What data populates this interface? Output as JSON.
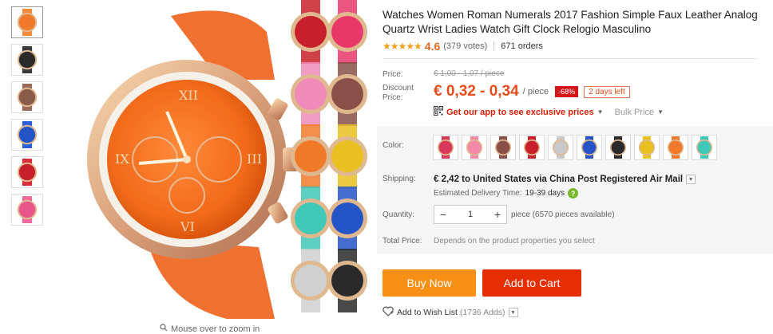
{
  "thumbnails": [
    {
      "face": "#f07a2a",
      "strap": "#f58c3a"
    },
    {
      "face": "#2a2a2a",
      "strap": "#3a3a3a"
    },
    {
      "face": "#8a5a4a",
      "strap": "#9a6a5a"
    },
    {
      "face": "#2554c7",
      "strap": "#2d5ed6"
    },
    {
      "face": "#c8202a",
      "strap": "#d8303a"
    },
    {
      "face": "#e8558a",
      "strap": "#f06a9a"
    }
  ],
  "zoom_hint": "Mouse over to zoom in",
  "product": {
    "title": "Watches Women Roman Numerals 2017 Fashion Simple Faux Leather Analog Quartz Wrist Ladies Watch Gift Clock Relogio Masculino",
    "stars": "★★★★★",
    "rating": "4.6",
    "votes": "(379 votes)",
    "orders": "671 orders"
  },
  "price": {
    "price_label": "Price:",
    "old_price": "€ 1,00 - 1,07 / piece",
    "discount_label_1": "Discount",
    "discount_label_2": "Price:",
    "current": "€ 0,32 - 0,34",
    "per": "/ piece",
    "discount": "-68%",
    "days_left": "2 days left",
    "app_text": "Get our app to see exclusive prices",
    "bulk": "Bulk Price"
  },
  "color": {
    "label": "Color:",
    "swatches": [
      "#d8385a",
      "#f08aa8",
      "#8a5048",
      "#c8202a",
      "#c8c8c8",
      "#2554c7",
      "#2a2a2a",
      "#e8c020",
      "#f07a2a",
      "#3fc7b8"
    ]
  },
  "shipping": {
    "label": "Shipping:",
    "text": "€ 2,42 to United States via China Post Registered Air Mail",
    "est_label": "Estimated Delivery Time:",
    "est_days": "19-39 days",
    "help": "?"
  },
  "quantity": {
    "label": "Quantity:",
    "minus": "−",
    "value": "1",
    "plus": "+",
    "note": "piece (6570 pieces available)"
  },
  "total": {
    "label": "Total Price:",
    "note": "Depends on the product properties you select"
  },
  "actions": {
    "buy_now": "Buy Now",
    "add_to_cart": "Add to Cart",
    "wish": "Add to Wish List",
    "wish_count": "(1736 Adds)"
  }
}
